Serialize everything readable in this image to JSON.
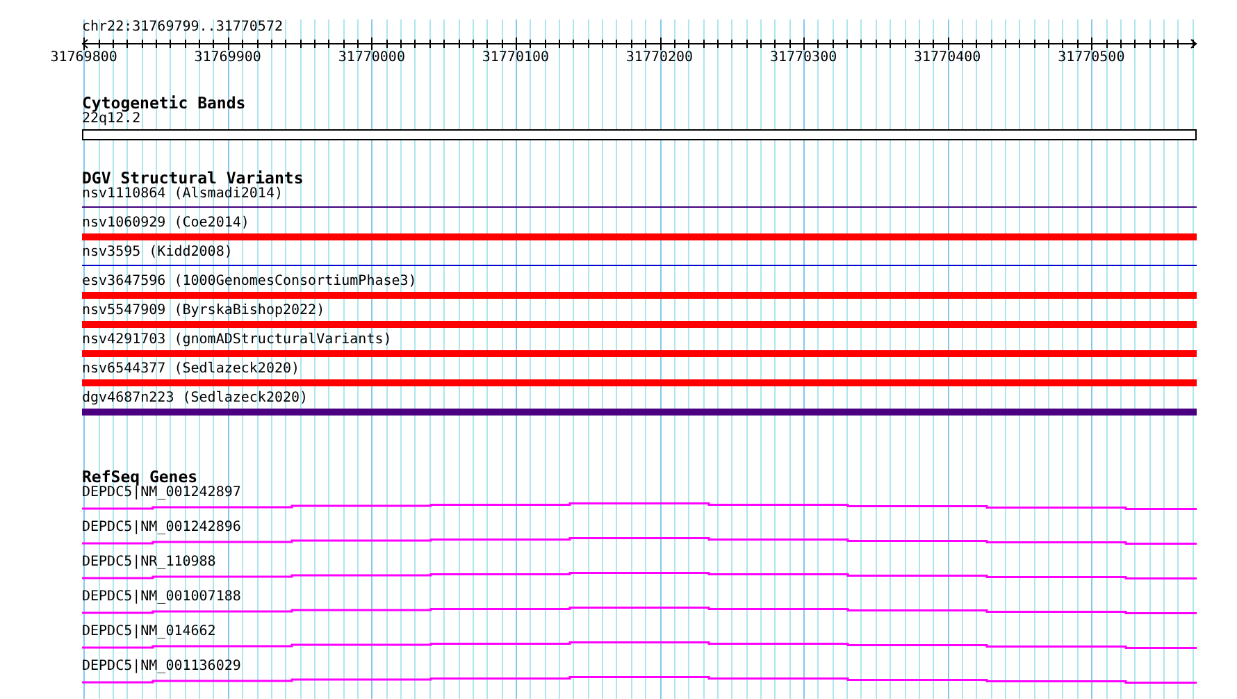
{
  "ruler": {
    "position_label": "chr22:31769799..31770572",
    "ticks": [
      "31769800",
      "31769900",
      "31770000",
      "31770100",
      "31770200",
      "31770300",
      "31770400",
      "31770500"
    ]
  },
  "cytogenetic_bands": {
    "title": "Cytogenetic Bands",
    "band": "22q12.2"
  },
  "dgv": {
    "title": "DGV Structural Variants",
    "items": [
      {
        "label": "nsv1110864 (Alsmadi2014)",
        "kind": "line",
        "color": "#400080"
      },
      {
        "label": "nsv1060929 (Coe2014)",
        "kind": "bar",
        "color": "#ff0000"
      },
      {
        "label": "nsv3595 (Kidd2008)",
        "kind": "line",
        "color": "#0000cc"
      },
      {
        "label": "esv3647596 (1000GenomesConsortiumPhase3)",
        "kind": "bar",
        "color": "#ff0000"
      },
      {
        "label": "nsv5547909 (ByrskaBishop2022)",
        "kind": "bar",
        "color": "#ff0000"
      },
      {
        "label": "nsv4291703 (gnomADStructuralVariants)",
        "kind": "bar",
        "color": "#ff0000"
      },
      {
        "label": "nsv6544377 (Sedlazeck2020)",
        "kind": "bar",
        "color": "#ff0000"
      },
      {
        "label": "dgv4687n223 (Sedlazeck2020)",
        "kind": "bar",
        "color": "#4b0082"
      }
    ]
  },
  "refseq": {
    "title": "RefSeq Genes",
    "genes": [
      {
        "label": "DEPDC5|NM_001242897"
      },
      {
        "label": "DEPDC5|NM_001242896"
      },
      {
        "label": "DEPDC5|NR_110988"
      },
      {
        "label": "DEPDC5|NM_001007188"
      },
      {
        "label": "DEPDC5|NM_014662"
      },
      {
        "label": "DEPDC5|NM_001136029"
      }
    ]
  }
}
